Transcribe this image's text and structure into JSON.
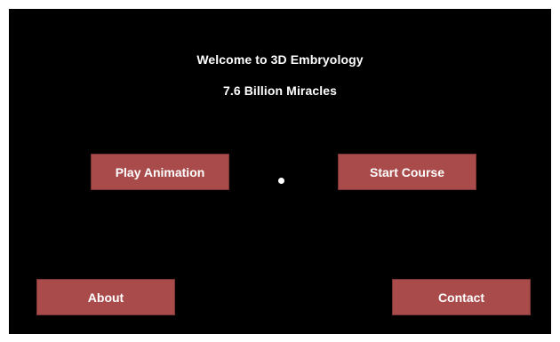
{
  "header": {
    "title": "Welcome to 3D Embryology",
    "subtitle": "7.6 Billion Miracles"
  },
  "buttons": {
    "play_animation": "Play Animation",
    "start_course": "Start Course",
    "about": "About",
    "contact": "Contact"
  },
  "colors": {
    "background": "#000000",
    "button": "#a94b4b",
    "text": "#ffffff"
  }
}
